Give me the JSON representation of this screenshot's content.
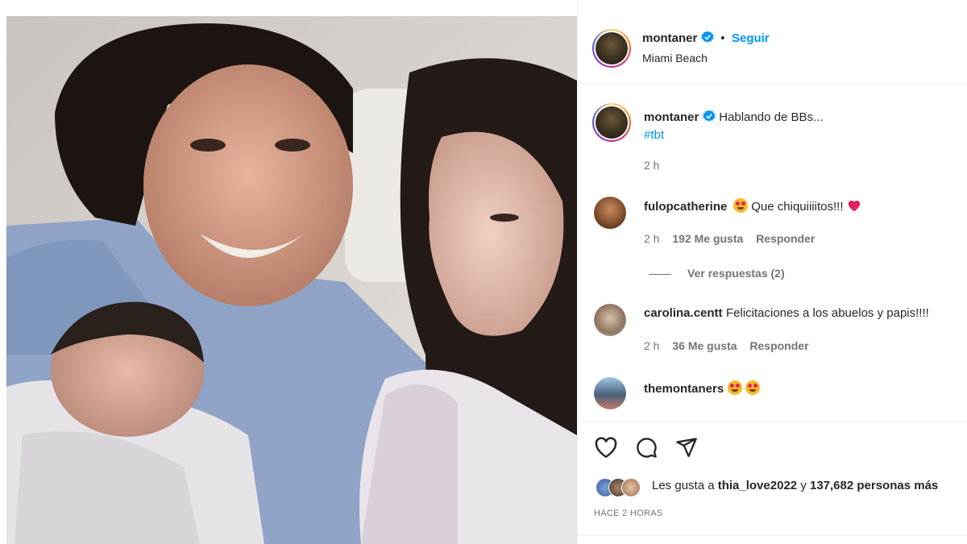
{
  "header": {
    "username": "montaner",
    "follow": "Seguir",
    "location": "Miami Beach"
  },
  "caption": {
    "username": "montaner",
    "text": "Hablando de BBs...",
    "hashtag": "#tbt",
    "time": "2 h"
  },
  "comments": [
    {
      "username": "fulopcatherine",
      "text": "Que chiquiiiitos!!!",
      "time": "2 h",
      "likes": "192 Me gusta",
      "reply": "Responder",
      "view_replies": "Ver respuestas (2)"
    },
    {
      "username": "carolina.centt",
      "text": "Felicitaciones a los abuelos y papis!!!!",
      "time": "2 h",
      "likes": "36 Me gusta",
      "reply": "Responder"
    },
    {
      "username": "themontaners",
      "text": ""
    }
  ],
  "likes": {
    "prefix": "Les gusta a",
    "user": "thia_love2022",
    "middle": "y",
    "count": "137,682 personas más"
  },
  "timestamp": "HACE 2 HORAS",
  "colors": {
    "accent": "#0095f6",
    "heart": "#ed4956",
    "text": "#262626",
    "muted": "#737373"
  },
  "icons": [
    "verified-badge-icon",
    "heart-icon",
    "comment-icon",
    "share-icon",
    "smiling-heart-eyes-emoji",
    "red-heart-emoji"
  ]
}
